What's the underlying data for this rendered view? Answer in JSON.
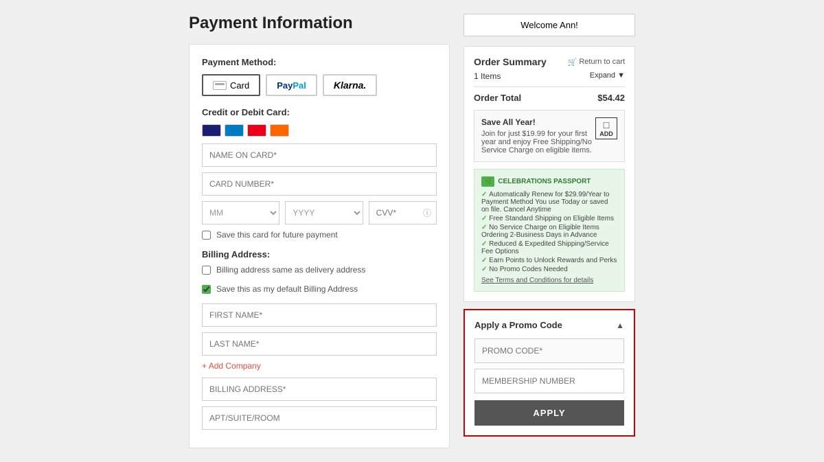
{
  "page": {
    "title": "Payment Information",
    "welcome_label": "Welcome Ann!"
  },
  "payment": {
    "method_label": "Payment Method:",
    "methods": [
      {
        "id": "card",
        "label": "Card",
        "active": true
      },
      {
        "id": "paypal",
        "label": "PayPal",
        "active": false
      },
      {
        "id": "klarna",
        "label": "Klarna.",
        "active": false
      }
    ],
    "card_label": "Credit or Debit Card:",
    "name_placeholder": "NAME ON CARD*",
    "number_placeholder": "CARD NUMBER*",
    "month_placeholder": "MM",
    "year_placeholder": "YYYY",
    "cvv_placeholder": "CVV*",
    "save_card_label": "Save this card for future payment"
  },
  "billing": {
    "label": "Billing Address:",
    "same_as_delivery_label": "Billing address same as delivery address",
    "default_billing_label": "Save this as my default Billing Address",
    "first_name_placeholder": "FIRST NAME*",
    "last_name_placeholder": "LAST NAME*",
    "add_company_label": "Add Company",
    "billing_address_placeholder": "BILLING ADDRESS*",
    "apt_placeholder": "APT/SUITE/ROOM"
  },
  "order_summary": {
    "title": "Order Summary",
    "return_cart": "Return to cart",
    "items": "1 Items",
    "expand": "Expand",
    "total_label": "Order Total",
    "total_value": "$54.42"
  },
  "save_offer": {
    "title": "Save All Year!",
    "description": "Join for just $19.99 for your first year and enjoy Free Shipping/No Service Charge on eligible items.",
    "add_label": "ADD"
  },
  "passport": {
    "label": "CELEBRATIONS PASSPORT",
    "features": [
      "Automatically Renew for $29.99/Year to Payment Method You use Today or saved on file. Cancel Anytime",
      "Free Standard Shipping on Eligible Items",
      "No Service Charge on Eligible Items Ordering 2-Business Days in Advance",
      "Reduced & Expedited Shipping/Service Fee Options",
      "Earn Points to Unlock Rewards and Perks",
      "No Promo Codes Needed"
    ],
    "terms_label": "See Terms and Conditions for details"
  },
  "promo": {
    "title": "Apply a Promo Code",
    "promo_placeholder": "PROMO CODE*",
    "membership_placeholder": "MEMBERSHIP NUMBER",
    "apply_label": "APPLY"
  }
}
